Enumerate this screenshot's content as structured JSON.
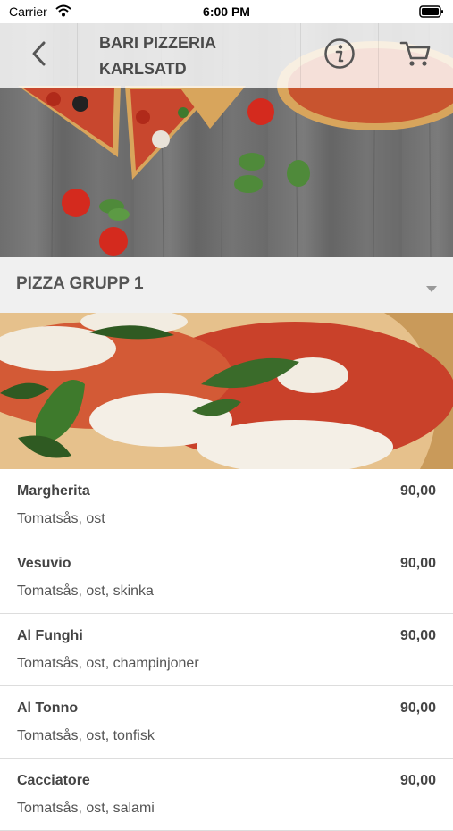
{
  "status_bar": {
    "carrier": "Carrier",
    "time": "6:00 PM"
  },
  "header": {
    "title_line1": "BARI PIZZERIA",
    "title_line2": "KARLSATD"
  },
  "group": {
    "title": "PIZZA GRUPP 1"
  },
  "menu_items": [
    {
      "name": "Margherita",
      "description": "Tomatsås, ost",
      "price": "90,00"
    },
    {
      "name": "Vesuvio",
      "description": "Tomatsås, ost, skinka",
      "price": "90,00"
    },
    {
      "name": "Al Funghi",
      "description": "Tomatsås, ost, champinjoner",
      "price": "90,00"
    },
    {
      "name": "Al Tonno",
      "description": "Tomatsås, ost, tonfisk",
      "price": "90,00"
    },
    {
      "name": "Cacciatore",
      "description": "Tomatsås, ost, salami",
      "price": "90,00"
    }
  ],
  "icons": {
    "back": "chevron-left-icon",
    "info": "info-icon",
    "cart": "cart-icon",
    "dropdown": "caret-down-icon",
    "wifi": "wifi-icon",
    "battery": "battery-icon"
  },
  "colors": {
    "header_text": "#4a4a4a",
    "group_bg": "#f0f0f0",
    "divider": "#dddddd"
  }
}
